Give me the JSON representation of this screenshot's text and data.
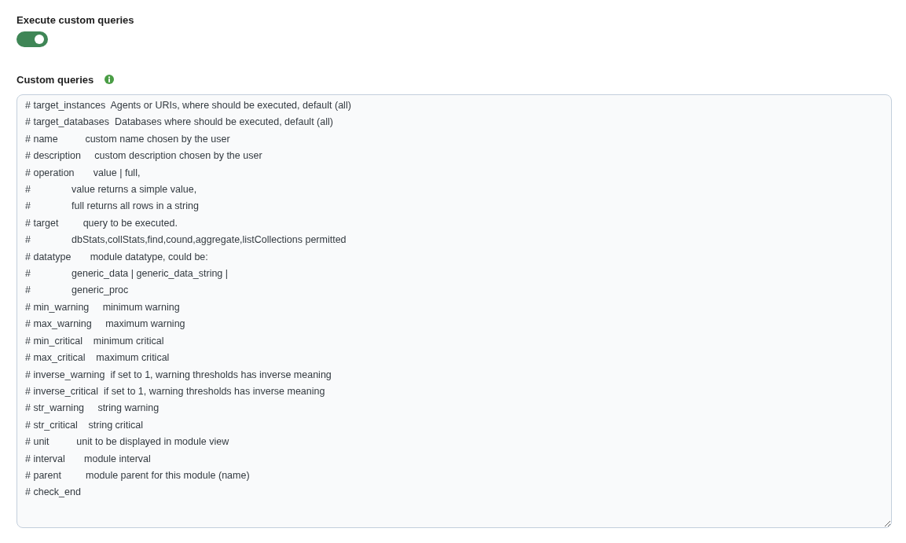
{
  "execute_custom_queries": {
    "label": "Execute custom queries",
    "on": true
  },
  "custom_queries": {
    "label": "Custom queries",
    "lines": [
      "# target_instances  Agents or URIs, where should be executed, default (all)",
      "# target_databases  Databases where should be executed, default (all)",
      "# name          custom name chosen by the user",
      "# description     custom description chosen by the user",
      "# operation       value | full,",
      "#               value returns a simple value,",
      "#               full returns all rows in a string",
      "# target         query to be executed.",
      "#               dbStats,collStats,find,cound,aggregate,listCollections permitted",
      "# datatype       module datatype, could be:",
      "#               generic_data | generic_data_string |",
      "#               generic_proc",
      "# min_warning     minimum warning",
      "# max_warning     maximum warning",
      "# min_critical    minimum critical",
      "# max_critical    maximum critical",
      "# inverse_warning  if set to 1, warning thresholds has inverse meaning",
      "# inverse_critical  if set to 1, warning thresholds has inverse meaning",
      "# str_warning     string warning",
      "# str_critical    string critical",
      "# unit          unit to be displayed in module view",
      "# interval       module interval",
      "# parent         module parent for this module (name)",
      "# check_end"
    ]
  }
}
